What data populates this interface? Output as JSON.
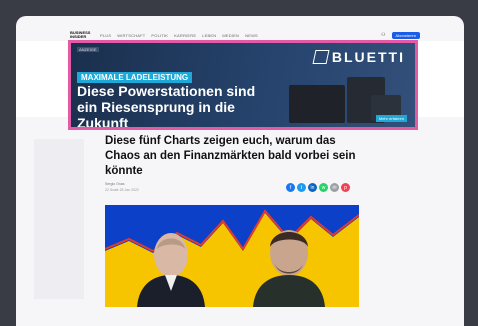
{
  "header": {
    "logo": "BUSINESS INSIDER",
    "nav": [
      "PLUS",
      "WIRTSCHAFT",
      "POLITIK",
      "KARRIERE",
      "LEBEN",
      "MEDIEN",
      "NEWS"
    ],
    "subscribe": "Abonnieren"
  },
  "ad": {
    "tag": "ANZEIGE",
    "brand": "BLUETTI",
    "kicker": "MAXIMALE LADELEISTUNG",
    "headline_line1": "Diese Powerstationen sind",
    "headline_line2": "ein Riesensprung in die Zukunft",
    "cta": "Mehr erfahren",
    "border_color": "#e35ba7"
  },
  "article": {
    "title": "Diese fünf Charts zeigen euch, warum das Chaos an den Finanzmärkten bald vorbei sein könnte",
    "author": "Sergio Gnas",
    "date": "22 Scale 25 Jan 2022"
  },
  "share_buttons": [
    {
      "icon": "facebook-icon",
      "glyph": "f",
      "color": "#1877f2"
    },
    {
      "icon": "twitter-icon",
      "glyph": "t",
      "color": "#1d9bf0"
    },
    {
      "icon": "linkedin-icon",
      "glyph": "in",
      "color": "#0a66c2"
    },
    {
      "icon": "whatsapp-icon",
      "glyph": "w",
      "color": "#25d366"
    },
    {
      "icon": "mail-icon",
      "glyph": "✉",
      "color": "#9aa0a6"
    },
    {
      "icon": "pocket-icon",
      "glyph": "p",
      "color": "#ef4056"
    }
  ]
}
